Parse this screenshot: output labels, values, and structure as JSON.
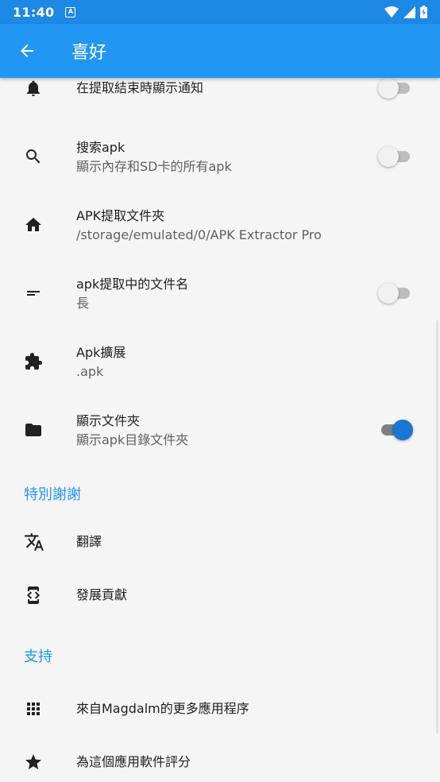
{
  "status": {
    "time": "11:40",
    "notif": "A"
  },
  "appbar": {
    "title": "喜好"
  },
  "settings": [
    {
      "title": "在提取結束時顯示通知",
      "summary": "",
      "icon": "notification-icon",
      "toggle": false
    },
    {
      "title": "搜索apk",
      "summary": "顯示內存和SD卡的所有apk",
      "icon": "search-icon",
      "toggle": false
    },
    {
      "title": "APK提取文件夾",
      "summary": "/storage/emulated/0/APK Extractor Pro",
      "icon": "home-icon"
    },
    {
      "title": "apk提取中的文件名",
      "summary": "長",
      "icon": "short-text-icon",
      "toggle": false
    },
    {
      "title": "Apk擴展",
      "summary": ".apk",
      "icon": "extension-icon"
    },
    {
      "title": "顯示文件夾",
      "summary": "顯示apk目錄文件夾",
      "icon": "folder-icon",
      "toggle": true
    }
  ],
  "sections": {
    "thanks": {
      "title": "特別謝謝",
      "items": [
        {
          "title": "翻譯",
          "icon": "translate-icon"
        },
        {
          "title": "發展貢獻",
          "icon": "developer-mode-icon"
        }
      ]
    },
    "support": {
      "title": "支持",
      "items": [
        {
          "title": "來自Magdalm的更多應用程序",
          "icon": "apps-grid-icon"
        },
        {
          "title": "為這個應用軟件評分",
          "icon": "star-icon"
        }
      ]
    }
  },
  "colors": {
    "primary": "#2196f3",
    "statusbar": "#1e88e5",
    "accent": "#1976d2"
  }
}
